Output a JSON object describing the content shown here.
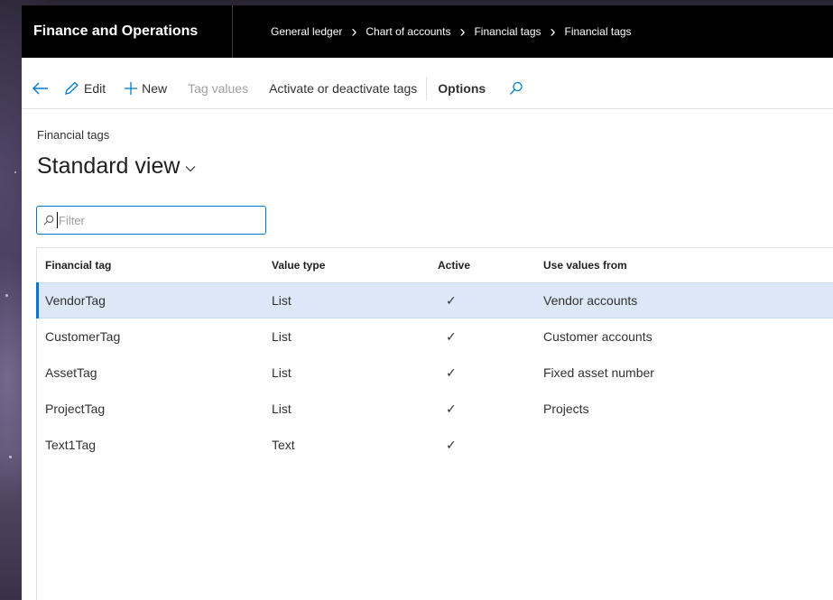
{
  "header": {
    "app_title": "Finance and Operations",
    "breadcrumbs": [
      "General ledger",
      "Chart of accounts",
      "Financial tags",
      "Financial tags"
    ]
  },
  "toolbar": {
    "back_icon": "back-arrow-icon",
    "edit_label": "Edit",
    "new_label": "New",
    "tag_values_label": "Tag values",
    "activate_label": "Activate or deactivate tags",
    "options_label": "Options",
    "search_icon": "search-icon"
  },
  "page": {
    "caption": "Financial tags",
    "view_title": "Standard view"
  },
  "filter": {
    "placeholder": "Filter",
    "value": ""
  },
  "grid": {
    "columns": [
      "Financial tag",
      "Value type",
      "Active",
      "Use values from"
    ],
    "rows": [
      {
        "tag": "VendorTag",
        "type": "List",
        "active": "✓",
        "source": "Vendor accounts",
        "selected": true
      },
      {
        "tag": "CustomerTag",
        "type": "List",
        "active": "✓",
        "source": "Customer accounts",
        "selected": false
      },
      {
        "tag": "AssetTag",
        "type": "List",
        "active": "✓",
        "source": "Fixed asset number",
        "selected": false
      },
      {
        "tag": "ProjectTag",
        "type": "List",
        "active": "✓",
        "source": "Projects",
        "selected": false
      },
      {
        "tag": "Text1Tag",
        "type": "Text",
        "active": "✓",
        "source": "",
        "selected": false
      }
    ]
  },
  "colors": {
    "topbar": "#000000",
    "accent": "#0078d4",
    "selected_row": "#dce8f7"
  }
}
